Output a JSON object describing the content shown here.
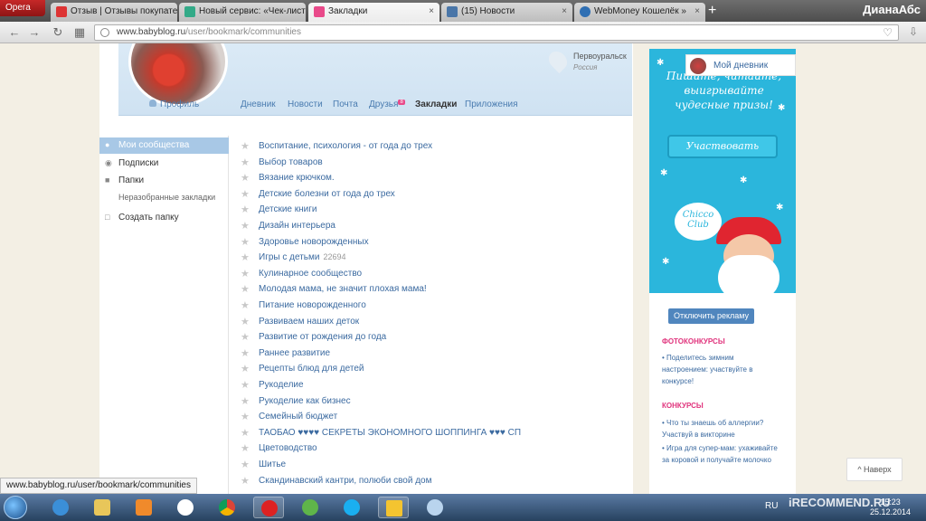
{
  "browser": {
    "menu_label": "Opera",
    "tabs": [
      {
        "title": "Отзыв | Отзывы покупате",
        "close": "×"
      },
      {
        "title": "Новый сервис: «Чек-лист",
        "close": "×"
      },
      {
        "title": "Закладки",
        "close": "×"
      },
      {
        "title": "(15) Новости",
        "close": "×"
      },
      {
        "title": "WebMoney Кошелёк »",
        "close": "×"
      }
    ],
    "new_tab": "+",
    "user": "ДианаАбс",
    "url_host": "www.babyblog.ru",
    "url_path": "/user/bookmark/communities",
    "status_url": "www.babyblog.ru/user/bookmark/communities"
  },
  "profile": {
    "location_city": "Первоуральск",
    "location_country": "Россия",
    "nav": {
      "profile": "Профиль",
      "diary": "Дневник",
      "news": "Новости",
      "mail": "Почта",
      "friends": "Друзья",
      "friends_badge": "8",
      "bookmarks": "Закладки",
      "apps": "Приложения"
    }
  },
  "sidebar": {
    "my_communities": "Мои сообщества",
    "subscriptions": "Подписки",
    "folders": "Папки",
    "unsorted": "Неразобранные закладки",
    "create_folder": "Создать папку"
  },
  "communities": [
    {
      "name": "Воспитание, психология - от года до трех",
      "count": ""
    },
    {
      "name": "Выбор товаров",
      "count": ""
    },
    {
      "name": "Вязание крючком.",
      "count": ""
    },
    {
      "name": "Детские болезни от года до трех",
      "count": ""
    },
    {
      "name": "Детские книги",
      "count": ""
    },
    {
      "name": "Дизайн интерьера",
      "count": ""
    },
    {
      "name": "Здоровье новорожденных",
      "count": ""
    },
    {
      "name": "Игры с детьми",
      "count": "22694"
    },
    {
      "name": "Кулинарное сообщество",
      "count": ""
    },
    {
      "name": "Молодая мама, не значит плохая мама!",
      "count": ""
    },
    {
      "name": "Питание новорожденного",
      "count": ""
    },
    {
      "name": "Развиваем наших деток",
      "count": ""
    },
    {
      "name": "Развитие от рождения до года",
      "count": ""
    },
    {
      "name": "Раннее развитие",
      "count": ""
    },
    {
      "name": "Рецепты блюд для детей",
      "count": ""
    },
    {
      "name": "Рукоделие",
      "count": ""
    },
    {
      "name": "Рукоделие как бизнес",
      "count": ""
    },
    {
      "name": "Семейный бюджет",
      "count": ""
    },
    {
      "name": "ТАОБАО ♥♥♥♥ СЕКРЕТЫ ЭКОНОМНОГО ШОППИНГА ♥♥♥ СП",
      "count": ""
    },
    {
      "name": "Цветоводство",
      "count": ""
    },
    {
      "name": "Шитье",
      "count": ""
    },
    {
      "name": "Скандинавский кантри, полюби свой дом",
      "count": ""
    }
  ],
  "banner": {
    "text": "Пишите, читайте, выигрывайте чудесные призы!",
    "button": "Участвовать",
    "brand": "Chicco Club",
    "my_diary": "Мой дневник"
  },
  "ads": {
    "disable": "Отключить рекламу",
    "photo_contest_head": "ФОТОКОНКУРСЫ",
    "photo_contest_text": "• Поделитесь зимним настроением: участвуйте в конкурсе!",
    "contests_head": "КОНКУРСЫ",
    "contest_1": "• Что ты знаешь об аллергии? Участвуй в викторине",
    "contest_2": "• Игра для супер-мам: ухаживайте за коровой и получайте молочко"
  },
  "back_to_top": "^ Наверх",
  "taskbar": {
    "lang": "RU",
    "time": "15:23",
    "date": "25.12.2014"
  },
  "watermark": "iRECOMMEND.RU"
}
